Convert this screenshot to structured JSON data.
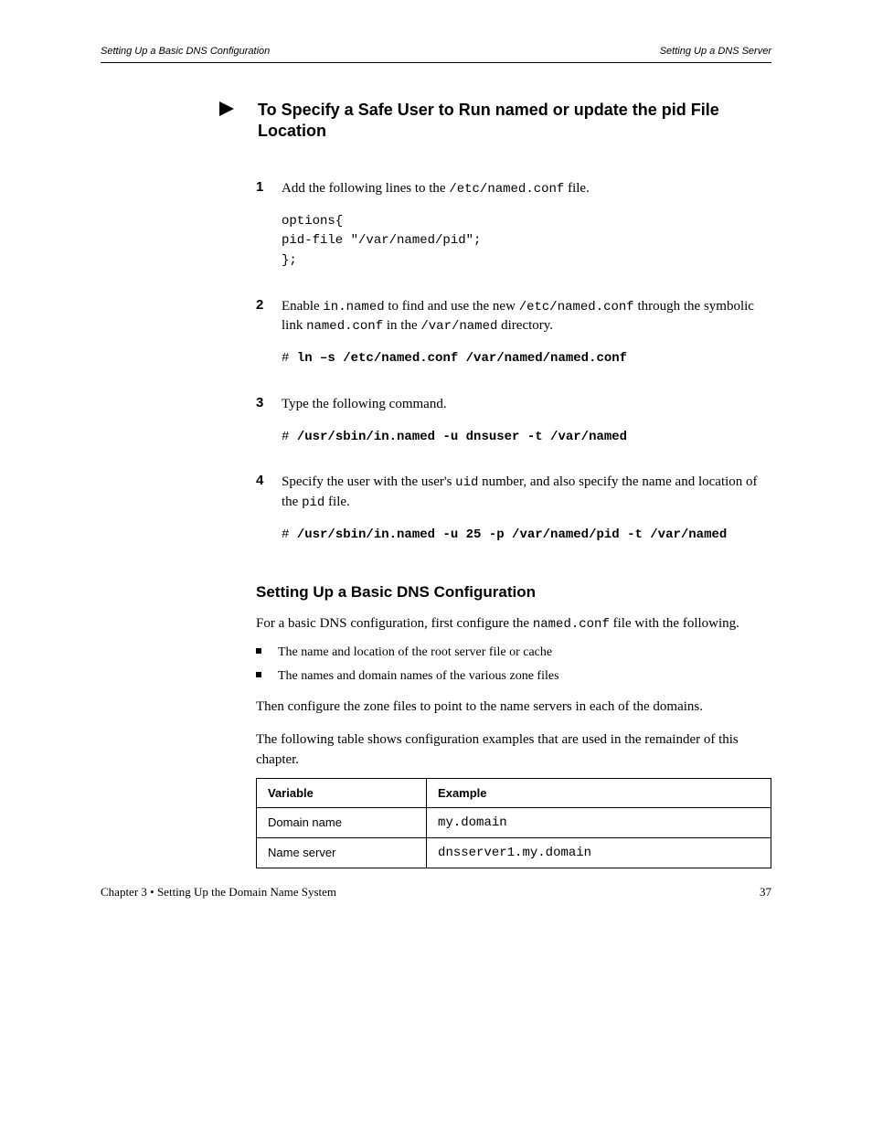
{
  "header": {
    "left": "Setting Up a Basic DNS Configuration",
    "right": "Setting Up a DNS Server"
  },
  "procedure": {
    "title": "To Specify a Safe User to Run named or update the pid File Location"
  },
  "steps": [
    {
      "num": "1",
      "lead": "Add the following lines to the ",
      "code_inline1": "/etc/named.conf",
      "tail": " file.",
      "code_block": "options{\npid-file \"/var/named/pid\";\n};"
    },
    {
      "num": "2",
      "text_before": "Enable",
      "code1": "in.named",
      "text_mid1": " to find and use the new ",
      "code2": "/etc/named.conf",
      "text_mid2": " through the symbolic link ",
      "code3": "named.conf",
      "text_mid3": " in the ",
      "code4": "/var/named",
      "text_mid4": " directory.",
      "cmd_prefix": "# ",
      "cmd_bold": "ln –s /etc/named.conf /var/named/named.conf"
    },
    {
      "num": "3",
      "lead": "Type the following command.",
      "cmd_prefix": "# ",
      "cmd_bold": "/usr/sbin/in.named -u dnsuser -t /var/named"
    },
    {
      "num": "4",
      "lead": "Specify the user with the user's ",
      "code1": "uid",
      "mid": " number, and also specify the name and location of the ",
      "code2": "pid",
      "tail": " file.",
      "cmd_prefix": "# ",
      "cmd_bold": "/usr/sbin/in.named -u 25 -p /var/named/pid -t /var/named"
    }
  ],
  "section_heading": "Setting Up a Basic DNS Configuration",
  "section_para1_lead": "For a basic DNS configuration, first configure the ",
  "section_para1_code": "named.conf",
  "section_para1_tail": " file with the following.",
  "section_bullets": [
    "The name and location of the root server file or cache",
    "The names and domain names of the various zone files"
  ],
  "section_para2": "Then configure the zone files to point to the name servers in each of the domains.",
  "table_caption": "The following table shows configuration examples that are used in the remainder of this chapter.",
  "table": {
    "headers": [
      "Variable",
      "Example"
    ],
    "rows": [
      [
        "Domain name",
        "my.domain"
      ],
      [
        "Name server",
        "dnsserver1.my.domain"
      ]
    ]
  },
  "footer": {
    "left": "Chapter 3 • Setting Up the Domain Name System",
    "right": "37"
  }
}
